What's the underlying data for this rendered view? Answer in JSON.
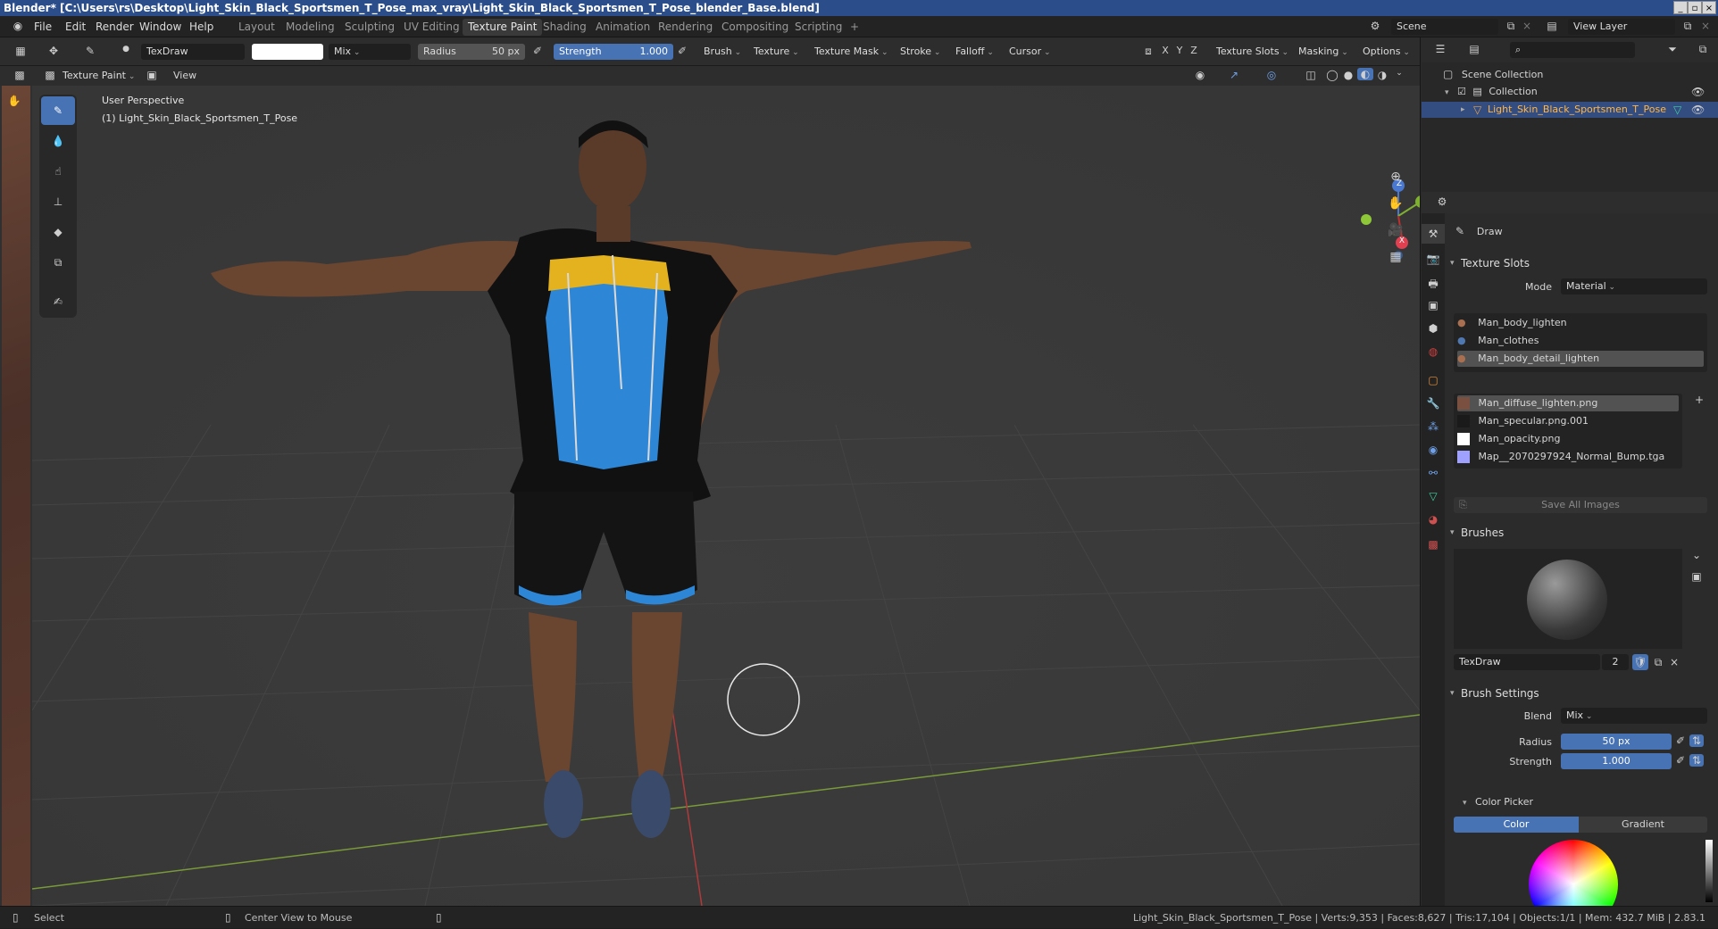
{
  "title": "Blender* [C:\\Users\\rs\\Desktop\\Light_Skin_Black_Sportsmen_T_Pose_max_vray\\Light_Skin_Black_Sportsmen_T_Pose_blender_Base.blend]",
  "menu": [
    "File",
    "Edit",
    "Render",
    "Window",
    "Help"
  ],
  "workspaces": [
    "Layout",
    "Modeling",
    "Sculpting",
    "UV Editing",
    "Texture Paint",
    "Shading",
    "Animation",
    "Rendering",
    "Compositing",
    "Scripting"
  ],
  "active_workspace": "Texture Paint",
  "scene": "Scene",
  "view_layer": "View Layer",
  "header": {
    "brush_name": "TexDraw",
    "blend": "Mix",
    "radius_label": "Radius",
    "radius_value": "50 px",
    "strength_label": "Strength",
    "strength_value": "1.000",
    "menus": [
      "Brush",
      "Texture",
      "Texture Mask",
      "Stroke",
      "Falloff",
      "Cursor"
    ],
    "axes": [
      "X",
      "Y",
      "Z"
    ],
    "right_menus": [
      "Texture Slots",
      "Masking",
      "Options"
    ],
    "mode": "Texture Paint",
    "view": "View"
  },
  "viewport": {
    "perspective": "User Perspective",
    "object": "(1) Light_Skin_Black_Sportsmen_T_Pose",
    "gizmo": {
      "z": "Z",
      "y": "Y",
      "x": "X"
    }
  },
  "outliner": {
    "scene_collection": "Scene Collection",
    "collection": "Collection",
    "object": "Light_Skin_Black_Sportsmen_T_Pose"
  },
  "properties": {
    "tool": "Draw",
    "texture_slots": "Texture Slots",
    "mode_label": "Mode",
    "mode_value": "Material",
    "materials": [
      "Man_body_lighten",
      "Man_clothes",
      "Man_body_detail_lighten"
    ],
    "images": [
      "Man_diffuse_lighten.png",
      "Man_specular.png.001",
      "Man_opacity.png",
      "Map__2070297924_Normal_Bump.tga"
    ],
    "save_all": "Save All Images",
    "brushes": "Brushes",
    "brush_name": "TexDraw",
    "brush_users": "2",
    "brush_settings": "Brush Settings",
    "blend_label": "Blend",
    "blend_value": "Mix",
    "radius_label": "Radius",
    "radius_value": "50 px",
    "strength_label": "Strength",
    "strength_value": "1.000",
    "color_picker": "Color Picker",
    "color_tab": "Color",
    "gradient_tab": "Gradient"
  },
  "status": {
    "select": "Select",
    "center": "Center View to Mouse",
    "stats": "Light_Skin_Black_Sportsmen_T_Pose | Verts:9,353 | Faces:8,627 | Tris:17,104 | Objects:1/1 | Mem: 432.7 MiB | 2.83.1"
  }
}
